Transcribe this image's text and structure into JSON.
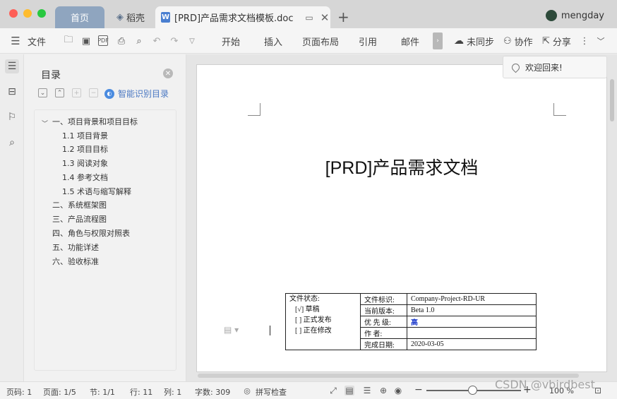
{
  "tabs": {
    "home": "首页",
    "daoke": "稻壳",
    "doc_title": "[PRD]产品需求文档模板.doc",
    "user": "mengday"
  },
  "toolbar": {
    "file": "文件",
    "menus": [
      "开始",
      "插入",
      "页面布局",
      "引用",
      "邮件"
    ],
    "sync": "未同步",
    "collab": "协作",
    "share": "分享"
  },
  "toast": "欢迎回来!",
  "outline": {
    "title": "目录",
    "smart": "智能识别目录",
    "items": [
      "一、项目背景和项目目标",
      "1.1 项目背景",
      "1.2 项目目标",
      "1.3 阅读对象",
      "1.4 参考文档",
      "1.5  术语与缩写解释",
      "二、系统框架图",
      "三、产品流程图",
      "四、角色与权限对照表",
      "五、功能详述",
      "六、验收标准"
    ]
  },
  "document": {
    "title": "[PRD]产品需求文档",
    "status_label": "文件状态:",
    "status_options": [
      "[√] 草稿",
      "[  ] 正式发布",
      "[  ] 正在修改"
    ],
    "rows": [
      {
        "key": "文件标识:",
        "value": "Company-Project-RD-UR"
      },
      {
        "key": "当前版本:",
        "value": "Beta 1.0"
      },
      {
        "key": "优 先 级:",
        "value": "高"
      },
      {
        "key": "作      者:",
        "value": ""
      },
      {
        "key": "完成日期:",
        "value": "2020-03-05"
      }
    ]
  },
  "statusbar": {
    "page_num": "页码: 1",
    "pages": "页面: 1/5",
    "section": "节: 1/1",
    "line": "行: 11",
    "col": "列: 1",
    "words": "字数: 309",
    "spell": "拼写检查",
    "zoom": "100 %"
  },
  "watermark": "CSDN @vbirdbest",
  "colors": {
    "accent": "#4a78c2",
    "priority": "#1f3ccc",
    "home_tab": "#8fa5bf"
  }
}
